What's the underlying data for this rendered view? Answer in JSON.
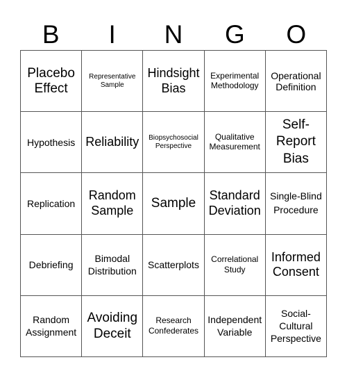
{
  "title_letters": [
    "B",
    "I",
    "N",
    "G",
    "O"
  ],
  "board": {
    "rows": [
      [
        "Placebo Effect",
        "Representative Sample",
        "Hindsight Bias",
        "Experimental Methodology",
        "Operational Definition"
      ],
      [
        "Hypothesis",
        "Reliability",
        "Biopsychosocial Perspective",
        "Qualitative Measurement",
        "Self-Report Bias"
      ],
      [
        "Replication",
        "Random Sample",
        "Sample",
        "Standard Deviation",
        "Single-Blind Procedure"
      ],
      [
        "Debriefing",
        "Bimodal Distribution",
        "Scatterplots",
        "Correlational Study",
        "Informed Consent"
      ],
      [
        "Random Assignment",
        "Avoiding Deceit",
        "Research Confederates",
        "Independent Variable",
        "Social-Cultural Perspective"
      ]
    ]
  },
  "colors": {
    "text": "#000000",
    "grid_line": "#555555",
    "background": "#ffffff"
  }
}
